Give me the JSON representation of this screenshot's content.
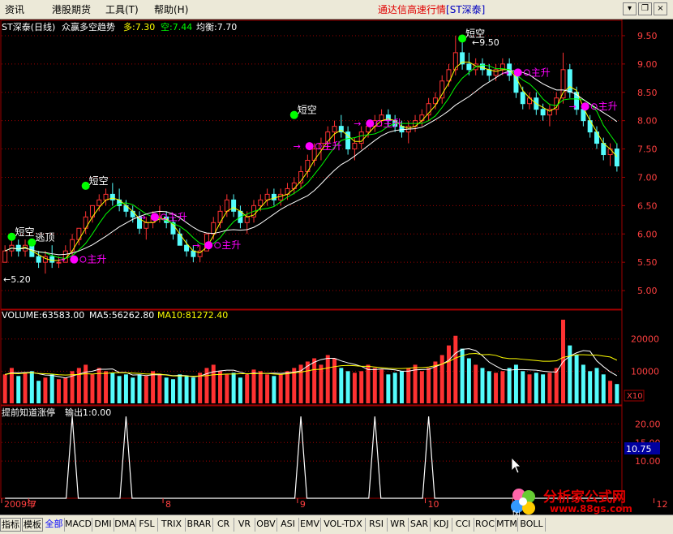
{
  "menu": {
    "items": [
      "资讯",
      "港股期货",
      "工具(T)",
      "帮助(H)"
    ]
  },
  "title": {
    "prefix": "通达信高速行情",
    "stock": "[ST深泰]"
  },
  "window_buttons": {
    "menu": "▾",
    "restore": "❐",
    "close": "×"
  },
  "main_panel": {
    "name": "ST深泰(日线)",
    "indicator": "众赢多空趋势",
    "bull_label": "多:7.30",
    "bear_label": "空:7.44",
    "balance_label": "均衡:7.70",
    "low_label": "←5.20",
    "high_label": "←9.50",
    "marks": {
      "short_sell": "短空",
      "escape_top": "逃顶",
      "main_rise": "主升",
      "arrow": "→"
    }
  },
  "volume_panel": {
    "volume_label": "VOLUME:63583.00",
    "ma5_label": "MA5:56262.80",
    "ma10_label": "MA10:81272.40",
    "unit_label": "X10"
  },
  "indicator_panel": {
    "title": "提前知道涨停",
    "output_label": "输出1:0.00",
    "current_value": "10.75"
  },
  "time_axis": {
    "labels": [
      {
        "text": "2009年",
        "pos": 0
      },
      {
        "text": "7",
        "pos": 4
      },
      {
        "text": "8",
        "pos": 24
      },
      {
        "text": "9",
        "pos": 44
      },
      {
        "text": "10",
        "pos": 63
      },
      {
        "text": "11",
        "pos": 76
      },
      {
        "text": "12",
        "pos": 97
      }
    ]
  },
  "tabs": [
    "指标",
    "模板",
    "全部",
    "MACD",
    "DMI",
    "DMA",
    "FSL",
    "TRIX",
    "BRAR",
    "CR",
    "VR",
    "OBV",
    "ASI",
    "EMV",
    "VOL-TDX",
    "RSI",
    "WR",
    "SAR",
    "KDJ",
    "CCI",
    "ROC",
    "MTM",
    "BOLL"
  ],
  "active_tab": "全部",
  "watermark": {
    "text": "分析家公式网",
    "url": "www.88gs.com",
    "logo_text": "fxj"
  },
  "colors": {
    "up": "#ff3232",
    "down": "#54fcfc",
    "bull": "#ffff00",
    "bear": "#00ff00",
    "balance": "#ffffff",
    "signal": "#ff00ff",
    "grid": "#a00000"
  },
  "chart_data": {
    "type": "candlestick",
    "price_axis": {
      "ylim": [
        4.7,
        9.7
      ],
      "ticks": [
        5.0,
        5.5,
        6.0,
        6.5,
        7.0,
        7.5,
        8.0,
        8.5,
        9.0,
        9.5
      ]
    },
    "volume_axis": {
      "ylim": [
        0,
        28000
      ],
      "ticks": [
        10000,
        20000
      ]
    },
    "indicator_axis": {
      "ylim": [
        0,
        24
      ],
      "ticks": [
        10.0,
        15.0,
        20.0
      ]
    },
    "candles": [
      [
        5.5,
        5.8,
        5.5,
        5.7
      ],
      [
        5.7,
        5.9,
        5.6,
        5.8
      ],
      [
        5.8,
        5.9,
        5.6,
        5.7
      ],
      [
        5.7,
        5.9,
        5.6,
        5.8
      ],
      [
        5.8,
        5.9,
        5.6,
        5.6
      ],
      [
        5.6,
        5.7,
        5.4,
        5.5
      ],
      [
        5.5,
        5.7,
        5.3,
        5.6
      ],
      [
        5.6,
        5.8,
        5.4,
        5.5
      ],
      [
        5.5,
        5.6,
        5.4,
        5.5
      ],
      [
        5.5,
        5.8,
        5.5,
        5.7
      ],
      [
        5.7,
        6.0,
        5.6,
        5.9
      ],
      [
        5.9,
        6.1,
        5.8,
        6.1
      ],
      [
        6.1,
        6.4,
        6.0,
        6.3
      ],
      [
        6.3,
        6.5,
        6.2,
        6.5
      ],
      [
        6.5,
        6.7,
        6.4,
        6.6
      ],
      [
        6.6,
        6.8,
        6.5,
        6.7
      ],
      [
        6.7,
        6.9,
        6.5,
        6.6
      ],
      [
        6.6,
        6.8,
        6.4,
        6.5
      ],
      [
        6.5,
        6.6,
        6.3,
        6.4
      ],
      [
        6.4,
        6.5,
        6.2,
        6.3
      ],
      [
        6.3,
        6.4,
        6.0,
        6.1
      ],
      [
        6.1,
        6.3,
        5.9,
        6.2
      ],
      [
        6.2,
        6.4,
        6.1,
        6.3
      ],
      [
        6.3,
        6.5,
        6.2,
        6.3
      ],
      [
        6.3,
        6.4,
        6.1,
        6.2
      ],
      [
        6.2,
        6.3,
        5.9,
        6.0
      ],
      [
        6.0,
        6.1,
        5.8,
        5.8
      ],
      [
        5.8,
        5.9,
        5.6,
        5.7
      ],
      [
        5.7,
        5.8,
        5.5,
        5.6
      ],
      [
        5.6,
        5.8,
        5.5,
        5.7
      ],
      [
        5.7,
        6.0,
        5.7,
        6.0
      ],
      [
        6.0,
        6.3,
        5.9,
        6.2
      ],
      [
        6.2,
        6.5,
        6.1,
        6.4
      ],
      [
        6.4,
        6.7,
        6.3,
        6.6
      ],
      [
        6.6,
        6.7,
        6.3,
        6.4
      ],
      [
        6.4,
        6.5,
        6.1,
        6.2
      ],
      [
        6.2,
        6.4,
        6.0,
        6.3
      ],
      [
        6.3,
        6.6,
        6.2,
        6.5
      ],
      [
        6.5,
        6.7,
        6.4,
        6.6
      ],
      [
        6.6,
        6.8,
        6.5,
        6.7
      ],
      [
        6.7,
        6.8,
        6.5,
        6.6
      ],
      [
        6.6,
        6.8,
        6.5,
        6.7
      ],
      [
        6.7,
        6.9,
        6.6,
        6.8
      ],
      [
        6.8,
        7.0,
        6.7,
        6.9
      ],
      [
        6.9,
        7.2,
        6.8,
        7.1
      ],
      [
        7.1,
        7.4,
        7.0,
        7.3
      ],
      [
        7.3,
        7.6,
        7.2,
        7.5
      ],
      [
        7.5,
        7.7,
        7.3,
        7.6
      ],
      [
        7.6,
        7.9,
        7.5,
        7.8
      ],
      [
        7.8,
        8.0,
        7.6,
        7.9
      ],
      [
        7.9,
        8.1,
        7.7,
        7.8
      ],
      [
        7.8,
        7.9,
        7.4,
        7.5
      ],
      [
        7.5,
        7.7,
        7.3,
        7.6
      ],
      [
        7.6,
        7.9,
        7.5,
        7.8
      ],
      [
        7.8,
        8.0,
        7.7,
        7.9
      ],
      [
        7.9,
        8.1,
        7.8,
        8.0
      ],
      [
        8.0,
        8.2,
        7.9,
        8.1
      ],
      [
        8.1,
        8.2,
        7.9,
        8.0
      ],
      [
        8.0,
        8.1,
        7.8,
        7.9
      ],
      [
        7.9,
        8.0,
        7.7,
        7.8
      ],
      [
        7.8,
        8.0,
        7.6,
        7.9
      ],
      [
        7.9,
        8.1,
        7.8,
        8.0
      ],
      [
        8.0,
        8.2,
        7.9,
        8.1
      ],
      [
        8.1,
        8.4,
        8.0,
        8.3
      ],
      [
        8.3,
        8.5,
        8.2,
        8.4
      ],
      [
        8.4,
        8.8,
        8.3,
        8.7
      ],
      [
        8.7,
        9.0,
        8.6,
        8.9
      ],
      [
        8.9,
        9.5,
        8.8,
        9.2
      ],
      [
        9.2,
        9.4,
        8.9,
        9.0
      ],
      [
        9.0,
        9.2,
        8.8,
        8.9
      ],
      [
        8.9,
        9.1,
        8.8,
        9.0
      ],
      [
        9.0,
        9.1,
        8.8,
        8.9
      ],
      [
        8.9,
        9.0,
        8.7,
        8.8
      ],
      [
        8.8,
        9.0,
        8.7,
        8.9
      ],
      [
        8.9,
        9.1,
        8.8,
        9.0
      ],
      [
        9.0,
        9.1,
        8.7,
        8.8
      ],
      [
        8.8,
        8.9,
        8.4,
        8.5
      ],
      [
        8.5,
        8.6,
        8.2,
        8.3
      ],
      [
        8.3,
        8.5,
        8.2,
        8.4
      ],
      [
        8.4,
        8.5,
        8.1,
        8.2
      ],
      [
        8.2,
        8.3,
        8.0,
        8.1
      ],
      [
        8.1,
        8.3,
        7.9,
        8.2
      ],
      [
        8.2,
        8.5,
        8.1,
        8.4
      ],
      [
        8.4,
        9.2,
        8.3,
        8.9
      ],
      [
        8.9,
        9.0,
        8.4,
        8.5
      ],
      [
        8.5,
        8.6,
        8.1,
        8.2
      ],
      [
        8.2,
        8.3,
        7.9,
        8.0
      ],
      [
        8.0,
        8.1,
        7.7,
        7.8
      ],
      [
        7.8,
        7.9,
        7.5,
        7.6
      ],
      [
        7.6,
        7.7,
        7.3,
        7.4
      ],
      [
        7.4,
        7.6,
        7.2,
        7.5
      ],
      [
        7.5,
        7.6,
        7.1,
        7.2
      ]
    ],
    "volumes": [
      9000,
      11000,
      8500,
      9500,
      10000,
      7000,
      8000,
      9000,
      7500,
      8000,
      10000,
      11000,
      12000,
      9000,
      11000,
      10000,
      9500,
      8500,
      9000,
      8000,
      9000,
      8500,
      10000,
      9000,
      8000,
      7500,
      9000,
      8500,
      8000,
      9500,
      11000,
      12000,
      10000,
      9000,
      9500,
      8000,
      9000,
      10500,
      10000,
      9000,
      8500,
      9000,
      10000,
      11000,
      12000,
      13000,
      14000,
      12000,
      15000,
      14000,
      11000,
      10000,
      9500,
      10000,
      12000,
      11000,
      10500,
      9000,
      9500,
      10000,
      11000,
      12000,
      10000,
      11000,
      13000,
      15000,
      18000,
      21000,
      17000,
      14000,
      12000,
      11000,
      10000,
      9500,
      10000,
      11000,
      12000,
      10000,
      9000,
      9500,
      9000,
      9500,
      11000,
      26000,
      18000,
      15000,
      12000,
      10000,
      11000,
      9000,
      7000,
      6000
    ],
    "ma5": [
      9000,
      9500,
      9500,
      9600,
      9600,
      9200,
      8800,
      8700,
      8300,
      7900,
      8500,
      9100,
      9700,
      10000,
      10600,
      10600,
      10700,
      9600,
      9600,
      8800,
      8900,
      8600,
      8900,
      8900,
      8900,
      8600,
      8700,
      8600,
      8200,
      8500,
      9200,
      9800,
      10100,
      10300,
      10300,
      9700,
      9100,
      9400,
      9300,
      9300,
      9400,
      9300,
      9500,
      9700,
      10100,
      11600,
      12800,
      13600,
      14000,
      14000,
      13200,
      12600,
      12100,
      11500,
      10500,
      10500,
      10700,
      10600,
      10400,
      10000,
      10000,
      10400,
      10500,
      10600,
      11400,
      12200,
      13400,
      15600,
      16800,
      17000,
      16400,
      14800,
      12800,
      11600,
      10500,
      10300,
      10500,
      10500,
      10400,
      10300,
      10000,
      9800,
      9700,
      13000,
      14700,
      15700,
      16400,
      16200,
      13200,
      11400,
      9800,
      8600
    ],
    "ma10": [
      9000,
      9300,
      9200,
      9400,
      9500,
      9300,
      9200,
      9100,
      8900,
      8800,
      8900,
      9000,
      9200,
      9100,
      9300,
      9300,
      9500,
      9500,
      9500,
      9400,
      9300,
      9100,
      9100,
      9100,
      8800,
      8500,
      8500,
      8500,
      8400,
      8500,
      8600,
      8900,
      9000,
      9100,
      9100,
      9200,
      9200,
      9200,
      9300,
      9300,
      9100,
      9000,
      9200,
      9500,
      9700,
      10100,
      10500,
      10600,
      11000,
      11400,
      11700,
      11800,
      11700,
      11500,
      11500,
      11300,
      11100,
      10900,
      10800,
      10800,
      10900,
      11100,
      11100,
      11300,
      11700,
      12200,
      13000,
      14100,
      14800,
      15400,
      15500,
      15100,
      15200,
      14900,
      14200,
      13900,
      13900,
      13700,
      13500,
      13300,
      13100,
      13100,
      13200,
      14300,
      14700,
      15100,
      15100,
      15000,
      15000,
      14700,
      14400,
      13400
    ],
    "indicator_spikes": [
      10,
      18,
      44,
      55,
      63
    ]
  }
}
